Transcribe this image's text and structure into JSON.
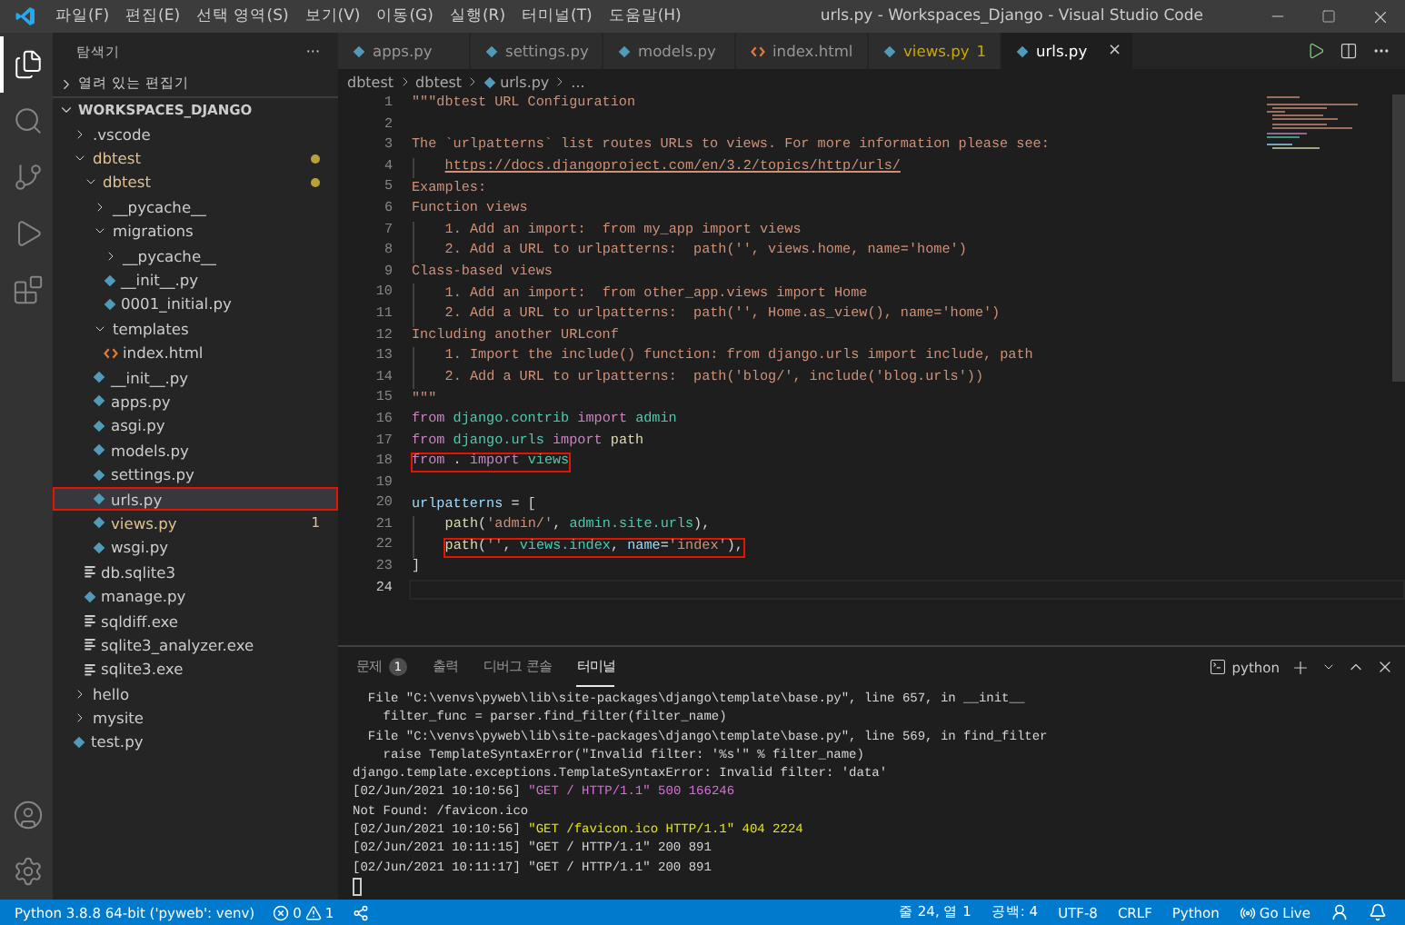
{
  "window": {
    "title": "urls.py - Workspaces_Django - Visual Studio Code"
  },
  "menu": [
    "파일(F)",
    "편집(E)",
    "선택 영역(S)",
    "보기(V)",
    "이동(G)",
    "실행(R)",
    "터미널(T)",
    "도움말(H)"
  ],
  "activity_bar": [
    {
      "kind": "explorer",
      "selected": true
    },
    {
      "kind": "search",
      "selected": false
    },
    {
      "kind": "scm",
      "selected": false
    },
    {
      "kind": "debug",
      "selected": false
    },
    {
      "kind": "extensions",
      "selected": false
    }
  ],
  "activity_bar_bottom": [
    {
      "kind": "account"
    },
    {
      "kind": "settings"
    }
  ],
  "sidebar": {
    "title": "탐색기",
    "more": "···",
    "sections": [
      {
        "label": "열려 있는 편집기",
        "expanded": false
      },
      {
        "label": "WORKSPACES_DJANGO",
        "expanded": true
      }
    ],
    "tree": [
      {
        "label": ".vscode",
        "kind": "folder",
        "expanded": false,
        "modified": false,
        "warning": false,
        "selected": false,
        "boxed": false
      },
      {
        "label": "dbtest",
        "kind": "folder",
        "expanded": true,
        "modified": true,
        "warning": false,
        "selected": false,
        "boxed": false,
        "children": [
          {
            "label": "dbtest",
            "kind": "folder",
            "expanded": true,
            "modified": true,
            "warning": false,
            "selected": false,
            "boxed": false,
            "children": [
              {
                "label": "__pycache__",
                "kind": "folder",
                "expanded": false,
                "modified": false,
                "warning": false,
                "selected": false,
                "boxed": false
              },
              {
                "label": "migrations",
                "kind": "folder",
                "expanded": true,
                "modified": false,
                "warning": false,
                "selected": false,
                "boxed": false,
                "children": [
                  {
                    "label": "__pycache__",
                    "kind": "folder",
                    "expanded": false,
                    "modified": false,
                    "warning": false,
                    "selected": false,
                    "boxed": false
                  },
                  {
                    "label": "__init__.py",
                    "kind": "python",
                    "modified": false,
                    "warning": false,
                    "selected": false,
                    "boxed": false
                  },
                  {
                    "label": "0001_initial.py",
                    "kind": "python",
                    "modified": false,
                    "warning": false,
                    "selected": false,
                    "boxed": false
                  }
                ]
              },
              {
                "label": "templates",
                "kind": "folder",
                "expanded": true,
                "modified": false,
                "warning": false,
                "selected": false,
                "boxed": false,
                "children": [
                  {
                    "label": "index.html",
                    "kind": "html",
                    "modified": false,
                    "warning": false,
                    "selected": false,
                    "boxed": false
                  }
                ]
              },
              {
                "label": "__init__.py",
                "kind": "python",
                "modified": false,
                "warning": false,
                "selected": false,
                "boxed": false
              },
              {
                "label": "apps.py",
                "kind": "python",
                "modified": false,
                "warning": false,
                "selected": false,
                "boxed": false
              },
              {
                "label": "asgi.py",
                "kind": "python",
                "modified": false,
                "warning": false,
                "selected": false,
                "boxed": false
              },
              {
                "label": "models.py",
                "kind": "python",
                "modified": false,
                "warning": false,
                "selected": false,
                "boxed": false
              },
              {
                "label": "settings.py",
                "kind": "python",
                "modified": false,
                "warning": false,
                "selected": false,
                "boxed": false
              },
              {
                "label": "urls.py",
                "kind": "python",
                "modified": false,
                "warning": false,
                "selected": true,
                "boxed": true
              },
              {
                "label": "views.py",
                "kind": "python",
                "modified": false,
                "warning": true,
                "badge": "1",
                "selected": false,
                "boxed": false
              },
              {
                "label": "wsgi.py",
                "kind": "python",
                "modified": false,
                "warning": false,
                "selected": false,
                "boxed": false
              }
            ]
          },
          {
            "label": "db.sqlite3",
            "kind": "file",
            "modified": false,
            "warning": false,
            "selected": false,
            "boxed": false
          },
          {
            "label": "manage.py",
            "kind": "python",
            "modified": false,
            "warning": false,
            "selected": false,
            "boxed": false
          },
          {
            "label": "sqldiff.exe",
            "kind": "file",
            "modified": false,
            "warning": false,
            "selected": false,
            "boxed": false
          },
          {
            "label": "sqlite3_analyzer.exe",
            "kind": "file",
            "modified": false,
            "warning": false,
            "selected": false,
            "boxed": false
          },
          {
            "label": "sqlite3.exe",
            "kind": "file",
            "modified": false,
            "warning": false,
            "selected": false,
            "boxed": false
          }
        ]
      },
      {
        "label": "hello",
        "kind": "folder",
        "expanded": false,
        "modified": false,
        "warning": false,
        "selected": false,
        "boxed": false
      },
      {
        "label": "mysite",
        "kind": "folder",
        "expanded": false,
        "modified": false,
        "warning": false,
        "selected": false,
        "boxed": false
      },
      {
        "label": "test.py",
        "kind": "python",
        "modified": false,
        "warning": false,
        "selected": false,
        "boxed": false
      }
    ]
  },
  "tabs": [
    {
      "label": "apps.py",
      "kind": "python",
      "warning": false,
      "selected": false
    },
    {
      "label": "settings.py",
      "kind": "python",
      "warning": false,
      "selected": false
    },
    {
      "label": "models.py",
      "kind": "python",
      "warning": false,
      "selected": false
    },
    {
      "label": "index.html",
      "kind": "html",
      "warning": false,
      "selected": false
    },
    {
      "label": "views.py",
      "kind": "python",
      "warning": true,
      "badge": "1",
      "selected": false
    },
    {
      "label": "urls.py",
      "kind": "python",
      "warning": false,
      "selected": true,
      "close": "×"
    }
  ],
  "breadcrumb": [
    {
      "label": "dbtest",
      "kind": "folder"
    },
    {
      "label": "dbtest",
      "kind": "folder"
    },
    {
      "label": "urls.py",
      "kind": "python"
    },
    {
      "label": "...",
      "kind": "more"
    }
  ],
  "code": [
    {
      "number": "1",
      "indented": false,
      "boxed": false,
      "current": false,
      "tokens": [
        {
          "kind": "doc",
          "text": "\"\"\"dbtest URL Configuration"
        }
      ]
    },
    {
      "number": "2",
      "indented": false,
      "current": false
    },
    {
      "number": "3",
      "indented": false,
      "boxed": false,
      "current": false,
      "tokens": [
        {
          "kind": "doc",
          "text": "The `urlpatterns` list routes URLs to views. For more information please see:"
        }
      ]
    },
    {
      "number": "4",
      "indented": true,
      "boxed": false,
      "current": false,
      "tokens": [
        {
          "kind": "link",
          "text": "https://docs.djangoproject.com/en/3.2/topics/http/urls/"
        }
      ]
    },
    {
      "number": "5",
      "indented": false,
      "boxed": false,
      "current": false,
      "tokens": [
        {
          "kind": "doc",
          "text": "Examples:"
        }
      ]
    },
    {
      "number": "6",
      "indented": false,
      "boxed": false,
      "current": false,
      "tokens": [
        {
          "kind": "doc",
          "text": "Function views"
        }
      ]
    },
    {
      "number": "7",
      "indented": true,
      "boxed": false,
      "current": false,
      "tokens": [
        {
          "kind": "doc",
          "text": "1. Add an import:  from my_app import views"
        }
      ]
    },
    {
      "number": "8",
      "indented": true,
      "boxed": false,
      "current": false,
      "tokens": [
        {
          "kind": "doc",
          "text": "2. Add a URL to urlpatterns:  path('', views.home, name='home')"
        }
      ]
    },
    {
      "number": "9",
      "indented": false,
      "boxed": false,
      "current": false,
      "tokens": [
        {
          "kind": "doc",
          "text": "Class-based views"
        }
      ]
    },
    {
      "number": "10",
      "indented": true,
      "boxed": false,
      "current": false,
      "tokens": [
        {
          "kind": "doc",
          "text": "1. Add an import:  from other_app.views import Home"
        }
      ]
    },
    {
      "number": "11",
      "indented": true,
      "boxed": false,
      "current": false,
      "tokens": [
        {
          "kind": "doc",
          "text": "2. Add a URL to urlpatterns:  path('', Home.as_view(), name='home')"
        }
      ]
    },
    {
      "number": "12",
      "indented": false,
      "boxed": false,
      "current": false,
      "tokens": [
        {
          "kind": "doc",
          "text": "Including another URLconf"
        }
      ]
    },
    {
      "number": "13",
      "indented": true,
      "boxed": false,
      "current": false,
      "tokens": [
        {
          "kind": "doc",
          "text": "1. Import the include() function: from django.urls import include, path"
        }
      ]
    },
    {
      "number": "14",
      "indented": true,
      "boxed": false,
      "current": false,
      "tokens": [
        {
          "kind": "doc",
          "text": "2. Add a URL to urlpatterns:  path('blog/', include('blog.urls'))"
        }
      ]
    },
    {
      "number": "15",
      "indented": false,
      "boxed": false,
      "current": false,
      "tokens": [
        {
          "kind": "doc",
          "text": "\"\"\""
        }
      ]
    },
    {
      "number": "16",
      "indented": false,
      "boxed": false,
      "current": false,
      "tokens": [
        {
          "kind": "keyword",
          "text": "from "
        },
        {
          "kind": "module",
          "text": "django.contrib "
        },
        {
          "kind": "keyword",
          "text": "import "
        },
        {
          "kind": "module",
          "text": "admin"
        }
      ]
    },
    {
      "number": "17",
      "indented": false,
      "boxed": false,
      "current": false,
      "tokens": [
        {
          "kind": "keyword",
          "text": "from "
        },
        {
          "kind": "module",
          "text": "django.urls "
        },
        {
          "kind": "keyword",
          "text": "import "
        },
        {
          "kind": "function",
          "text": "path"
        }
      ]
    },
    {
      "number": "18",
      "indented": false,
      "boxed": true,
      "current": false,
      "tokens": [
        {
          "kind": "keyword",
          "text": "from "
        },
        {
          "kind": "plain",
          "text": ". "
        },
        {
          "kind": "keyword",
          "text": "import "
        },
        {
          "kind": "module",
          "text": "views"
        }
      ]
    },
    {
      "number": "19",
      "indented": false,
      "current": false
    },
    {
      "number": "20",
      "indented": false,
      "boxed": false,
      "current": false,
      "tokens": [
        {
          "kind": "variable",
          "text": "urlpatterns"
        },
        {
          "kind": "plain",
          "text": " = ["
        }
      ]
    },
    {
      "number": "21",
      "indented": true,
      "boxed": false,
      "current": false,
      "tokens": [
        {
          "kind": "function",
          "text": "path"
        },
        {
          "kind": "plain",
          "text": "("
        },
        {
          "kind": "string",
          "text": "'admin/'"
        },
        {
          "kind": "plain",
          "text": ", "
        },
        {
          "kind": "module",
          "text": "admin.site.urls"
        },
        {
          "kind": "plain",
          "text": "),"
        }
      ]
    },
    {
      "number": "22",
      "indented": true,
      "boxed": true,
      "current": false,
      "tokens": [
        {
          "kind": "function",
          "text": "path"
        },
        {
          "kind": "plain",
          "text": "("
        },
        {
          "kind": "string",
          "text": "''"
        },
        {
          "kind": "plain",
          "text": ", "
        },
        {
          "kind": "module",
          "text": "views.index"
        },
        {
          "kind": "plain",
          "text": ", "
        },
        {
          "kind": "variable",
          "text": "name"
        },
        {
          "kind": "plain",
          "text": "="
        },
        {
          "kind": "string",
          "text": "'index'"
        },
        {
          "kind": "plain",
          "text": "),"
        }
      ]
    },
    {
      "number": "23",
      "indented": false,
      "boxed": false,
      "current": false,
      "tokens": [
        {
          "kind": "plain",
          "text": "]"
        }
      ]
    },
    {
      "number": "24",
      "indented": false,
      "current": true
    }
  ],
  "panel": {
    "tabs": [
      {
        "label": "문제",
        "badge": "1",
        "selected": false
      },
      {
        "label": "출력",
        "selected": false
      },
      {
        "label": "디버그 콘솔",
        "selected": false
      },
      {
        "label": "터미널",
        "selected": true
      }
    ],
    "terminal_name": "python",
    "terminal": [
      {
        "tokens": [
          {
            "kind": "plain",
            "text": "  File \"C:\\venvs\\pyweb\\lib\\site-packages\\django\\template\\base.py\", line 657, in __init__"
          }
        ]
      },
      {
        "tokens": [
          {
            "kind": "plain",
            "text": "    filter_func = parser.find_filter(filter_name)"
          }
        ]
      },
      {
        "tokens": [
          {
            "kind": "plain",
            "text": "  File \"C:\\venvs\\pyweb\\lib\\site-packages\\django\\template\\base.py\", line 569, in find_filter"
          }
        ]
      },
      {
        "tokens": [
          {
            "kind": "plain",
            "text": "    raise TemplateSyntaxError(\"Invalid filter: '%s'\" % filter_name)"
          }
        ]
      },
      {
        "tokens": [
          {
            "kind": "plain",
            "text": "django.template.exceptions.TemplateSyntaxError: Invalid filter: 'data'"
          }
        ]
      },
      {
        "tokens": [
          {
            "kind": "plain",
            "text": "[02/Jun/2021 10:10:56] "
          },
          {
            "kind": "magenta",
            "text": "\"GET / HTTP/1.1\" 500 166246"
          }
        ]
      },
      {
        "tokens": [
          {
            "kind": "plain",
            "text": "Not Found: /favicon.ico"
          }
        ]
      },
      {
        "tokens": [
          {
            "kind": "plain",
            "text": "[02/Jun/2021 10:10:56] "
          },
          {
            "kind": "yellow",
            "text": "\"GET /favicon.ico HTTP/1.1\" 404 2224"
          }
        ]
      },
      {
        "tokens": [
          {
            "kind": "plain",
            "text": "[02/Jun/2021 10:11:15] \"GET / HTTP/1.1\" 200 891"
          }
        ]
      },
      {
        "tokens": [
          {
            "kind": "plain",
            "text": "[02/Jun/2021 10:11:17] \"GET / HTTP/1.1\" 200 891"
          }
        ]
      }
    ],
    "cursor": true
  },
  "status_bar": {
    "interpreter": "Python 3.8.8 64-bit ('pyweb': venv)",
    "errors": "0",
    "warnings": "1",
    "right": [
      {
        "kind": "text",
        "label": "줄 24, 열 1"
      },
      {
        "kind": "text",
        "label": "공백: 4"
      },
      {
        "kind": "text",
        "label": "UTF-8"
      },
      {
        "kind": "text",
        "label": "CRLF"
      },
      {
        "kind": "text",
        "label": "Python"
      },
      {
        "kind": "golive",
        "label": "Go Live"
      },
      {
        "kind": "feedback"
      },
      {
        "kind": "bell"
      }
    ]
  }
}
